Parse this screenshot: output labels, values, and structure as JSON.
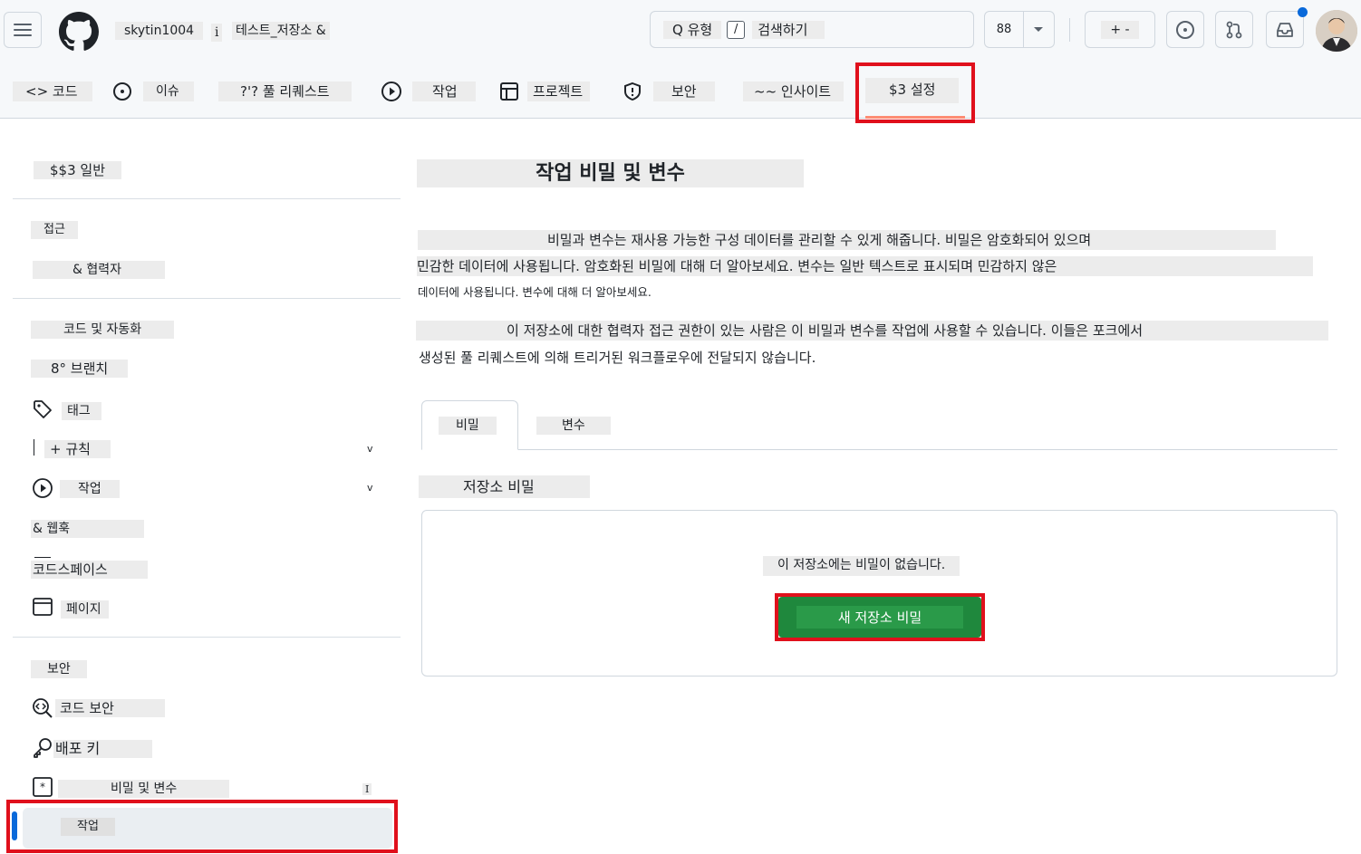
{
  "header": {
    "username": "skytin1004",
    "separator": "i",
    "repo_name": "테스트_저장소 &",
    "search": {
      "prefix": "Q 유형",
      "slash": "/",
      "label": "검색하기"
    },
    "copilot_label": "88",
    "plus_label": "+ -"
  },
  "repo_tabs": [
    {
      "label": "<> 코드"
    },
    {
      "label": "이슈"
    },
    {
      "label": "?'? 풀 리퀘스트"
    },
    {
      "label": "작업"
    },
    {
      "label": "프로젝트"
    },
    {
      "label": "보안"
    },
    {
      "label": "~~ 인사이트"
    },
    {
      "label": "$3 설정"
    }
  ],
  "sidebar": {
    "general": "$$3 일반",
    "access_heading": "접근",
    "collaborators": "& 협력자",
    "code_automation_heading": "코드 및 자동화",
    "branches": "8° 브랜치",
    "tags": "태그",
    "rules": "+ 규칙",
    "actions": "작업",
    "webhooks": "& 웹훅",
    "codespaces": "코드스페이스",
    "pages": "페이지",
    "security_heading": "보안",
    "code_security": "코드 보안",
    "deploy_keys": "배포 키",
    "secrets_variables": "비밀 및 변수",
    "secrets_badge": "I",
    "actions_sub": "작업",
    "caret": "v"
  },
  "main": {
    "title": "작업 비밀 및 변수",
    "desc_line1": "비밀과 변수는 재사용 가능한 구성 데이터를 관리할 수 있게 해줍니다. 비밀은 암호화되어 있으며",
    "desc_line2": "민감한 데이터에 사용됩니다. 암호화된 비밀에 대해 더 알아보세요. 변수는 일반 텍스트로 표시되며 민감하지 않은",
    "desc_line3": "데이터에 사용됩니다. 변수에 대해 더 알아보세요.",
    "access_line1": "이 저장소에 대한 협력자 접근 권한이 있는 사람은 이 비밀과 변수를 작업에 사용할 수 있습니다. 이들은 포크에서",
    "access_line2": "생성된 풀 리퀘스트에 의해 트리거된 워크플로우에 전달되지 않습니다.",
    "tab_secrets": "비밀",
    "tab_variables": "변수",
    "repo_secrets_heading": "저장소 비밀",
    "empty_message": "이 저장소에는 비밀이 없습니다.",
    "new_secret_button": "새 저장소 비밀"
  },
  "colors": {
    "highlight": "#e0101c",
    "primary_button": "#1f883d",
    "active_indicator": "#0969da",
    "notification_dot": "#0969da"
  }
}
